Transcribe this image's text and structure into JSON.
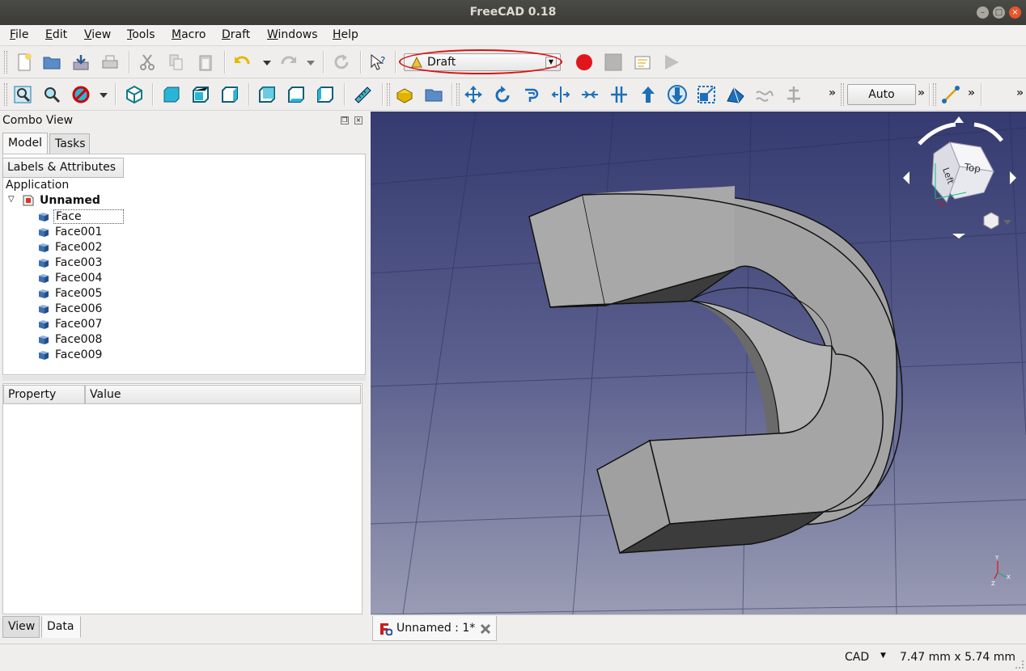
{
  "window": {
    "title": "FreeCAD 0.18"
  },
  "menu": [
    {
      "label": "File",
      "u": "F",
      "rest": "ile"
    },
    {
      "label": "Edit",
      "u": "E",
      "rest": "dit"
    },
    {
      "label": "View",
      "u": "V",
      "rest": "iew"
    },
    {
      "label": "Tools",
      "u": "T",
      "rest": "ools"
    },
    {
      "label": "Macro",
      "u": "M",
      "rest": "acro"
    },
    {
      "label": "Draft",
      "u": "D",
      "rest": "raft"
    },
    {
      "label": "Windows",
      "u": "W",
      "rest": "indows"
    },
    {
      "label": "Help",
      "u": "H",
      "rest": "elp"
    }
  ],
  "workbench": {
    "selected": "Draft"
  },
  "toolbar": {
    "auto_label": "Auto",
    "overflow": "»"
  },
  "combo": {
    "title": "Combo View",
    "tabs": {
      "model": "Model",
      "tasks": "Tasks"
    },
    "labels_header": "Labels & Attributes",
    "application": "Application",
    "document": "Unnamed",
    "items": [
      "Face",
      "Face001",
      "Face002",
      "Face003",
      "Face004",
      "Face005",
      "Face006",
      "Face007",
      "Face008",
      "Face009"
    ],
    "property_header": "Property",
    "value_header": "Value",
    "bottom_tabs": {
      "view": "View",
      "data": "Data"
    }
  },
  "navcube": {
    "top": "Top",
    "left": "Left"
  },
  "document_tab": {
    "label": "Unnamed : 1*"
  },
  "status": {
    "nav_style": "CAD",
    "dimensions": "7.47 mm x 5.74 mm"
  },
  "colors": {
    "accent_red": "#dd1111",
    "face_icon": "#3d6fb0"
  }
}
